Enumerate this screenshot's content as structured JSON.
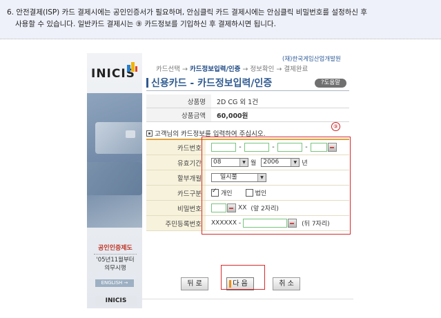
{
  "instruction": {
    "line1": "6. 안전결제(ISP) 카드 결제시에는 공인인증서가 필요하며, 안심클릭 카드 결제시에는 안심클릭 비밀번호를 설정하신 후",
    "line2": "사용할 수 있습니다.  일반카드 결제시는 ⑨ 카드정보를 기입하신 후 결제하시면 됩니다."
  },
  "sidebar": {
    "logo": "INICIS",
    "cert_title": "공인인증제도",
    "cert_line1": "'05년11월부터",
    "cert_line2": "의무시행",
    "english": "ENGLISH →",
    "logo_bottom": "INICIS"
  },
  "header": {
    "org": "(재)한국게임산업개발원",
    "steps": {
      "s1": "카드선택",
      "arrow": "→",
      "s2": "카드정보입력/인증",
      "s3": "정보확인",
      "s4": "결제완료"
    },
    "title": "신용카드 - 카드정보입력/인증",
    "help": "?도움말"
  },
  "product": {
    "name_label": "상품명",
    "name_value": "2D CG 외 1건",
    "price_label": "상품금액",
    "price_value": "60,000원"
  },
  "form": {
    "request": "고객님의 카드정보를 입력하여 주십시오.",
    "callout": "⑨",
    "card_number_label": "카드번호",
    "expiry_label": "유효기간",
    "expiry_month": "08",
    "month_unit": "월",
    "expiry_year": "2006",
    "year_unit": "년",
    "installment_label": "할부개월",
    "installment_value": "일시불",
    "card_type_label": "카드구분",
    "personal": "개인",
    "corporate": "법인",
    "password_label": "비밀번호",
    "password_suffix": "XX",
    "password_hint": "(앞 2자리)",
    "rrn_label": "주민등록번호",
    "rrn_prefix": "XXXXXX -",
    "rrn_hint": "(뒤 7자리)"
  },
  "buttons": {
    "back": "뒤 로",
    "next": "다 음",
    "cancel": "취 소"
  },
  "colors": {
    "accent": "#2e5a90",
    "highlight_red": "#d62a2a",
    "form_bg": "#f7f2dc",
    "orange": "#e0a23c"
  }
}
